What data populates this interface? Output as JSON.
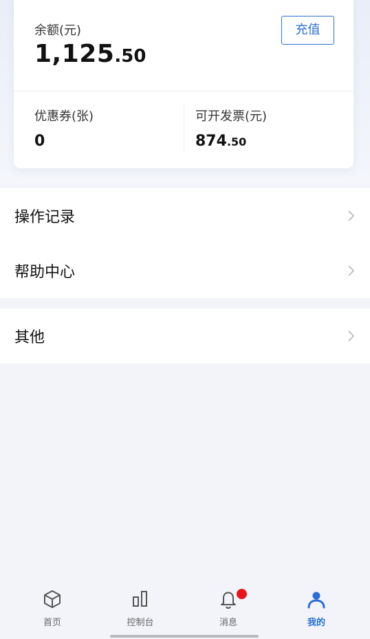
{
  "account": {
    "balance_label": "余额(元)",
    "balance_int": "1,125",
    "balance_dec": ".50",
    "recharge_label": "充值"
  },
  "stats": {
    "coupon_label": "优惠券(张)",
    "coupon_value": "0",
    "invoice_label": "可开发票(元)",
    "invoice_int": "874",
    "invoice_dec": ".50"
  },
  "menu": {
    "records": "操作记录",
    "help": "帮助中心",
    "other": "其他"
  },
  "tabbar": {
    "tabs": [
      {
        "label": "首页",
        "icon": "cube-icon"
      },
      {
        "label": "控制台",
        "icon": "bar-chart-icon"
      },
      {
        "label": "消息",
        "icon": "bell-icon"
      },
      {
        "label": "我的",
        "icon": "user-icon"
      }
    ],
    "active_index": 3,
    "message_badge": true
  },
  "colors": {
    "accent": "#2b6fd6",
    "badge": "#e8141b",
    "background": "#f2f4f9"
  }
}
